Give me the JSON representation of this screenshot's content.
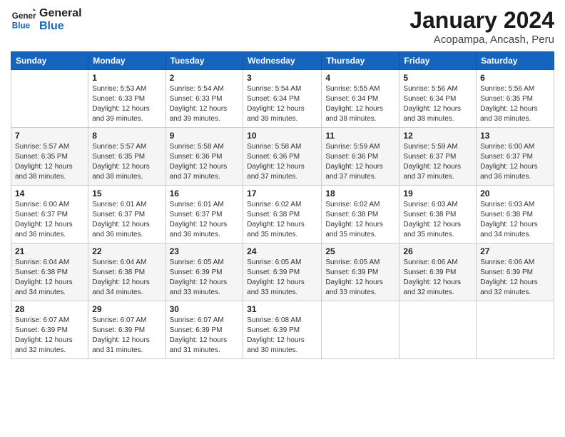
{
  "logo": {
    "line1": "General",
    "line2": "Blue"
  },
  "title": "January 2024",
  "subtitle": "Acopampa, Ancash, Peru",
  "days_of_week": [
    "Sunday",
    "Monday",
    "Tuesday",
    "Wednesday",
    "Thursday",
    "Friday",
    "Saturday"
  ],
  "weeks": [
    [
      {
        "day": "",
        "info": ""
      },
      {
        "day": "1",
        "info": "Sunrise: 5:53 AM\nSunset: 6:33 PM\nDaylight: 12 hours\nand 39 minutes."
      },
      {
        "day": "2",
        "info": "Sunrise: 5:54 AM\nSunset: 6:33 PM\nDaylight: 12 hours\nand 39 minutes."
      },
      {
        "day": "3",
        "info": "Sunrise: 5:54 AM\nSunset: 6:34 PM\nDaylight: 12 hours\nand 39 minutes."
      },
      {
        "day": "4",
        "info": "Sunrise: 5:55 AM\nSunset: 6:34 PM\nDaylight: 12 hours\nand 38 minutes."
      },
      {
        "day": "5",
        "info": "Sunrise: 5:56 AM\nSunset: 6:34 PM\nDaylight: 12 hours\nand 38 minutes."
      },
      {
        "day": "6",
        "info": "Sunrise: 5:56 AM\nSunset: 6:35 PM\nDaylight: 12 hours\nand 38 minutes."
      }
    ],
    [
      {
        "day": "7",
        "info": "Sunrise: 5:57 AM\nSunset: 6:35 PM\nDaylight: 12 hours\nand 38 minutes."
      },
      {
        "day": "8",
        "info": "Sunrise: 5:57 AM\nSunset: 6:35 PM\nDaylight: 12 hours\nand 38 minutes."
      },
      {
        "day": "9",
        "info": "Sunrise: 5:58 AM\nSunset: 6:36 PM\nDaylight: 12 hours\nand 37 minutes."
      },
      {
        "day": "10",
        "info": "Sunrise: 5:58 AM\nSunset: 6:36 PM\nDaylight: 12 hours\nand 37 minutes."
      },
      {
        "day": "11",
        "info": "Sunrise: 5:59 AM\nSunset: 6:36 PM\nDaylight: 12 hours\nand 37 minutes."
      },
      {
        "day": "12",
        "info": "Sunrise: 5:59 AM\nSunset: 6:37 PM\nDaylight: 12 hours\nand 37 minutes."
      },
      {
        "day": "13",
        "info": "Sunrise: 6:00 AM\nSunset: 6:37 PM\nDaylight: 12 hours\nand 36 minutes."
      }
    ],
    [
      {
        "day": "14",
        "info": "Sunrise: 6:00 AM\nSunset: 6:37 PM\nDaylight: 12 hours\nand 36 minutes."
      },
      {
        "day": "15",
        "info": "Sunrise: 6:01 AM\nSunset: 6:37 PM\nDaylight: 12 hours\nand 36 minutes."
      },
      {
        "day": "16",
        "info": "Sunrise: 6:01 AM\nSunset: 6:37 PM\nDaylight: 12 hours\nand 36 minutes."
      },
      {
        "day": "17",
        "info": "Sunrise: 6:02 AM\nSunset: 6:38 PM\nDaylight: 12 hours\nand 35 minutes."
      },
      {
        "day": "18",
        "info": "Sunrise: 6:02 AM\nSunset: 6:38 PM\nDaylight: 12 hours\nand 35 minutes."
      },
      {
        "day": "19",
        "info": "Sunrise: 6:03 AM\nSunset: 6:38 PM\nDaylight: 12 hours\nand 35 minutes."
      },
      {
        "day": "20",
        "info": "Sunrise: 6:03 AM\nSunset: 6:38 PM\nDaylight: 12 hours\nand 34 minutes."
      }
    ],
    [
      {
        "day": "21",
        "info": "Sunrise: 6:04 AM\nSunset: 6:38 PM\nDaylight: 12 hours\nand 34 minutes."
      },
      {
        "day": "22",
        "info": "Sunrise: 6:04 AM\nSunset: 6:38 PM\nDaylight: 12 hours\nand 34 minutes."
      },
      {
        "day": "23",
        "info": "Sunrise: 6:05 AM\nSunset: 6:39 PM\nDaylight: 12 hours\nand 33 minutes."
      },
      {
        "day": "24",
        "info": "Sunrise: 6:05 AM\nSunset: 6:39 PM\nDaylight: 12 hours\nand 33 minutes."
      },
      {
        "day": "25",
        "info": "Sunrise: 6:05 AM\nSunset: 6:39 PM\nDaylight: 12 hours\nand 33 minutes."
      },
      {
        "day": "26",
        "info": "Sunrise: 6:06 AM\nSunset: 6:39 PM\nDaylight: 12 hours\nand 32 minutes."
      },
      {
        "day": "27",
        "info": "Sunrise: 6:06 AM\nSunset: 6:39 PM\nDaylight: 12 hours\nand 32 minutes."
      }
    ],
    [
      {
        "day": "28",
        "info": "Sunrise: 6:07 AM\nSunset: 6:39 PM\nDaylight: 12 hours\nand 32 minutes."
      },
      {
        "day": "29",
        "info": "Sunrise: 6:07 AM\nSunset: 6:39 PM\nDaylight: 12 hours\nand 31 minutes."
      },
      {
        "day": "30",
        "info": "Sunrise: 6:07 AM\nSunset: 6:39 PM\nDaylight: 12 hours\nand 31 minutes."
      },
      {
        "day": "31",
        "info": "Sunrise: 6:08 AM\nSunset: 6:39 PM\nDaylight: 12 hours\nand 30 minutes."
      },
      {
        "day": "",
        "info": ""
      },
      {
        "day": "",
        "info": ""
      },
      {
        "day": "",
        "info": ""
      }
    ]
  ]
}
